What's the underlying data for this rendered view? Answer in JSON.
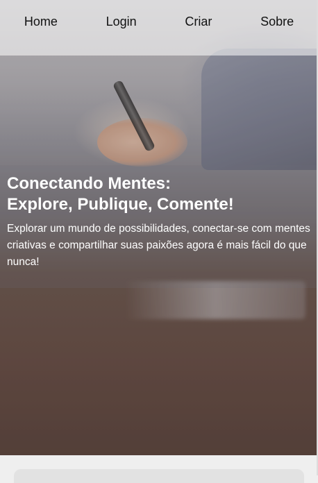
{
  "nav": {
    "items": [
      {
        "label": "Home"
      },
      {
        "label": "Login"
      },
      {
        "label": "Criar"
      },
      {
        "label": "Sobre"
      }
    ]
  },
  "hero": {
    "title_line1": "Conectando Mentes:",
    "title_line2": "Explore, Publique, Comente!",
    "description": "Explorar um mundo de possibilidades, conectar-se com mentes criativas e compartilhar suas paixões agora é mais fácil do que nunca!"
  }
}
